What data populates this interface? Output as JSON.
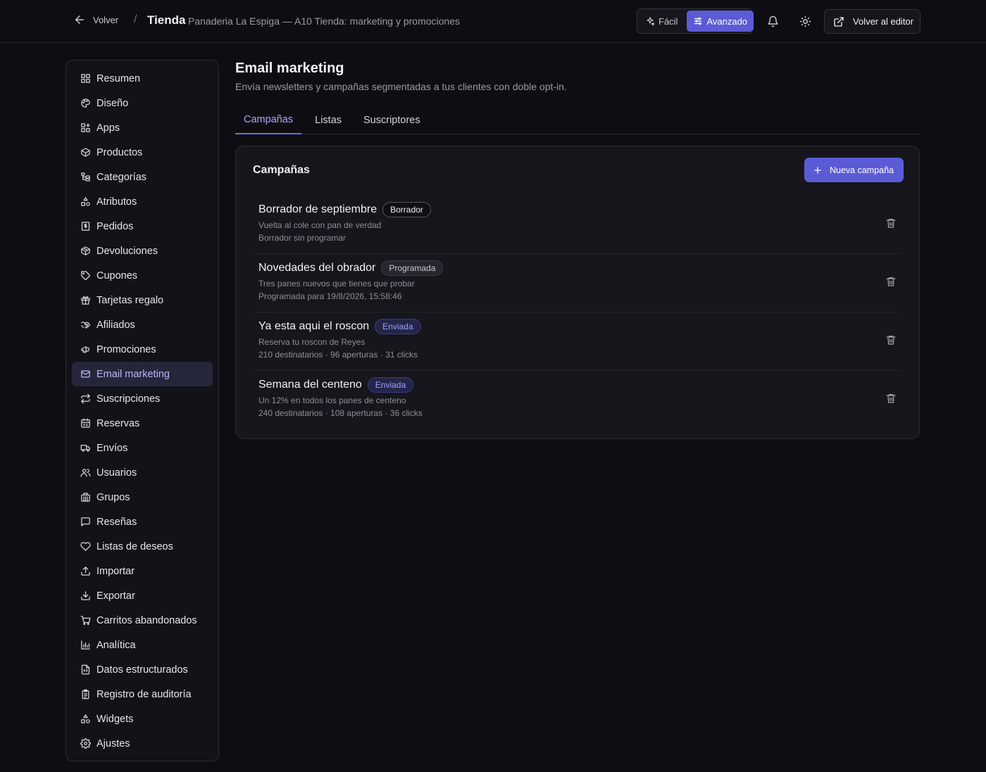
{
  "header": {
    "back_label": "Volver",
    "separator": "/",
    "title": "Tienda",
    "subtitle": "Panaderia La Espiga — A10 Tienda: marketing y promociones",
    "mode_easy": "Fácil",
    "mode_advanced": "Avanzado",
    "editor_label": "Volver al editor"
  },
  "sidebar": {
    "items": [
      {
        "label": "Resumen",
        "icon": "grid-icon"
      },
      {
        "label": "Diseño",
        "icon": "palette-icon"
      },
      {
        "label": "Apps",
        "icon": "apps-icon"
      },
      {
        "label": "Productos",
        "icon": "box-icon"
      },
      {
        "label": "Categorías",
        "icon": "tree-icon"
      },
      {
        "label": "Atributos",
        "icon": "shapes-icon"
      },
      {
        "label": "Pedidos",
        "icon": "receipt-icon"
      },
      {
        "label": "Devoluciones",
        "icon": "package-return-icon"
      },
      {
        "label": "Cupones",
        "icon": "tag-icon"
      },
      {
        "label": "Tarjetas regalo",
        "icon": "gift-icon"
      },
      {
        "label": "Afiliados",
        "icon": "handshake-icon"
      },
      {
        "label": "Promociones",
        "icon": "megaphone-icon"
      },
      {
        "label": "Email marketing",
        "icon": "mail-icon"
      },
      {
        "label": "Suscripciones",
        "icon": "repeat-icon"
      },
      {
        "label": "Reservas",
        "icon": "calendar-icon"
      },
      {
        "label": "Envíos",
        "icon": "truck-icon"
      },
      {
        "label": "Usuarios",
        "icon": "users-icon"
      },
      {
        "label": "Grupos",
        "icon": "building-icon"
      },
      {
        "label": "Reseñas",
        "icon": "message-icon"
      },
      {
        "label": "Listas de deseos",
        "icon": "heart-icon"
      },
      {
        "label": "Importar",
        "icon": "upload-icon"
      },
      {
        "label": "Exportar",
        "icon": "download-icon"
      },
      {
        "label": "Carritos abandonados",
        "icon": "cart-icon"
      },
      {
        "label": "Analítica",
        "icon": "bar-chart-icon"
      },
      {
        "label": "Datos estructurados",
        "icon": "file-code-icon"
      },
      {
        "label": "Registro de auditoría",
        "icon": "clipboard-icon"
      },
      {
        "label": "Widgets",
        "icon": "shapes-icon"
      },
      {
        "label": "Ajustes",
        "icon": "gear-icon"
      }
    ],
    "active_index": 12
  },
  "main": {
    "title": "Email marketing",
    "subtitle": "Envía newsletters y campañas segmentadas a tus clientes con doble opt-in.",
    "tabs": [
      "Campañas",
      "Listas",
      "Suscriptores"
    ],
    "card_title": "Campañas",
    "new_button": "Nueva campaña",
    "campaigns": [
      {
        "name": "Borrador de septiembre",
        "status": "Borrador",
        "subject": "Vuelta al cole con pan de verdad",
        "detail": "Borrador sin programar"
      },
      {
        "name": "Novedades del obrador",
        "status": "Programada",
        "subject": "Tres panes nuevos que tienes que probar",
        "detail": "Programada para 19/8/2026, 15:58:46"
      },
      {
        "name": "Ya esta aqui el roscon",
        "status": "Enviada",
        "subject": "Reserva tu roscon de Reyes",
        "detail": "210 destinatarios · 96 aperturas · 31 clicks"
      },
      {
        "name": "Semana del centeno",
        "status": "Enviada",
        "subject": "Un 12% en todos los panes de centeno",
        "detail": "240 destinatarios · 108 aperturas · 36 clicks"
      }
    ]
  },
  "colors": {
    "accent": "#5b5bd6",
    "background": "#0e0e12",
    "active_nav_bg": "#26263a"
  }
}
